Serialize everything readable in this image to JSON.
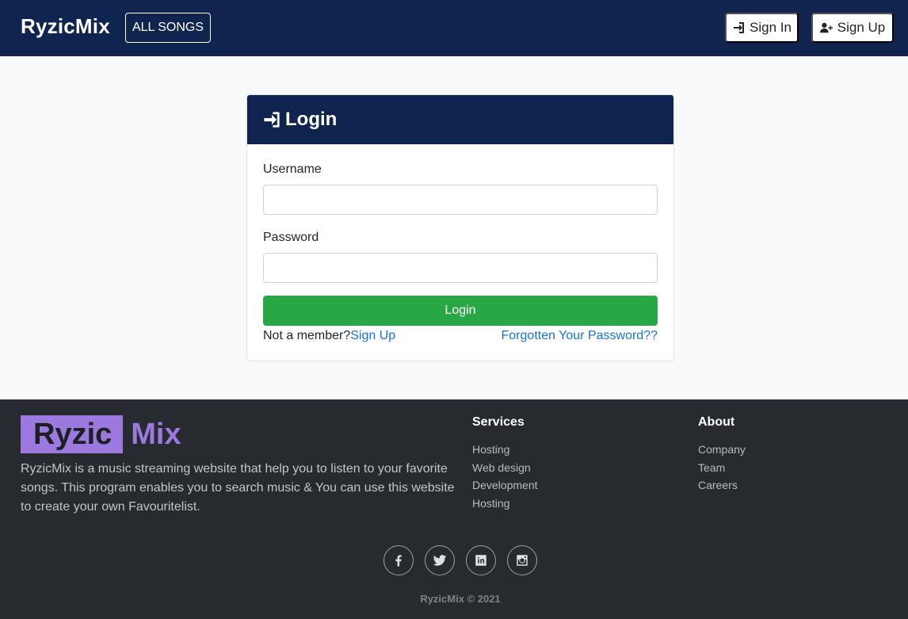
{
  "navbar": {
    "brand": "RyzicMix",
    "all_songs": "ALL SONGS",
    "sign_in": "Sign In",
    "sign_up": "Sign Up"
  },
  "login": {
    "title": "Login",
    "username_label": "Username",
    "username_value": "",
    "password_label": "Password",
    "password_value": "",
    "submit": "Login",
    "not_member": "Not a member?",
    "sign_up_link": "Sign Up",
    "forgot": "Forgotten Your Password??"
  },
  "footer": {
    "logo_part1": "Ryzic",
    "logo_part2": "Mix",
    "description": "RyzicMix is a music streaming website that help you to listen to your favorite songs. This program enables you to search music & You can use this website to create your own Favouritelist.",
    "services": {
      "heading": "Services",
      "items": [
        "Hosting",
        "Web design",
        "Development",
        "Hosting"
      ]
    },
    "about": {
      "heading": "About",
      "items": [
        "Company",
        "Team",
        "Careers"
      ]
    },
    "socials": [
      "facebook-icon",
      "twitter-icon",
      "linkedin-icon",
      "instagram-icon"
    ],
    "copyright": "RyzicMix © 2021"
  },
  "colors": {
    "navy": "#0f2550",
    "green": "#28a745",
    "link": "#1a73d9",
    "footer_bg": "#272b30",
    "accent_purple": "#9b79df"
  }
}
